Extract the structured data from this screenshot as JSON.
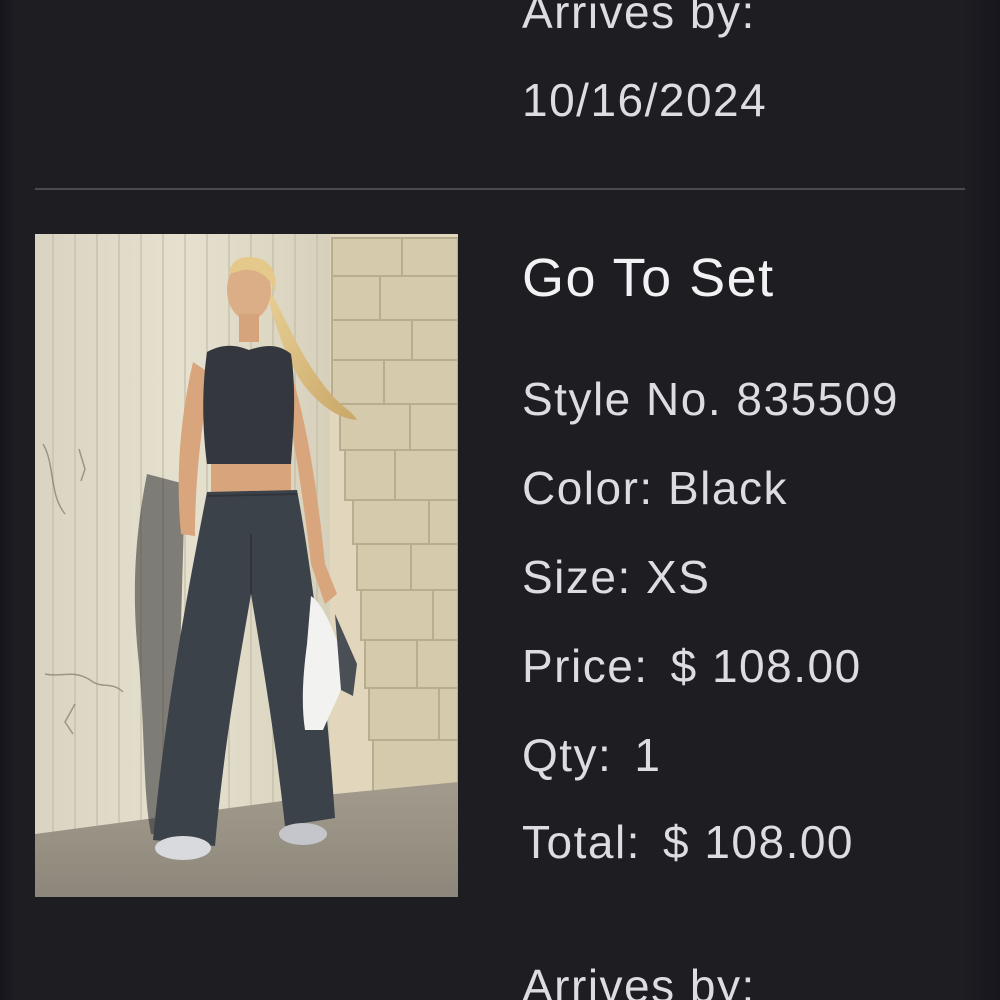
{
  "previous_item": {
    "arrives_label": "Arrives by:",
    "arrives_date": "10/16/2024"
  },
  "item": {
    "name": "Go To Set",
    "style_label": "Style No.",
    "style_number": "835509",
    "color_label": "Color:",
    "color_value": "Black",
    "size_label": "Size:",
    "size_value": "XS",
    "price_label": "Price:",
    "price_value": "$ 108.00",
    "qty_label": "Qty:",
    "qty_value": "1",
    "total_label": "Total:",
    "total_value": "$ 108.00",
    "arrives_label": "Arrives by:"
  },
  "colors": {
    "background": "#242229",
    "card": "#1e1d22",
    "text": "#dddce0",
    "divider": "#4a494f"
  }
}
